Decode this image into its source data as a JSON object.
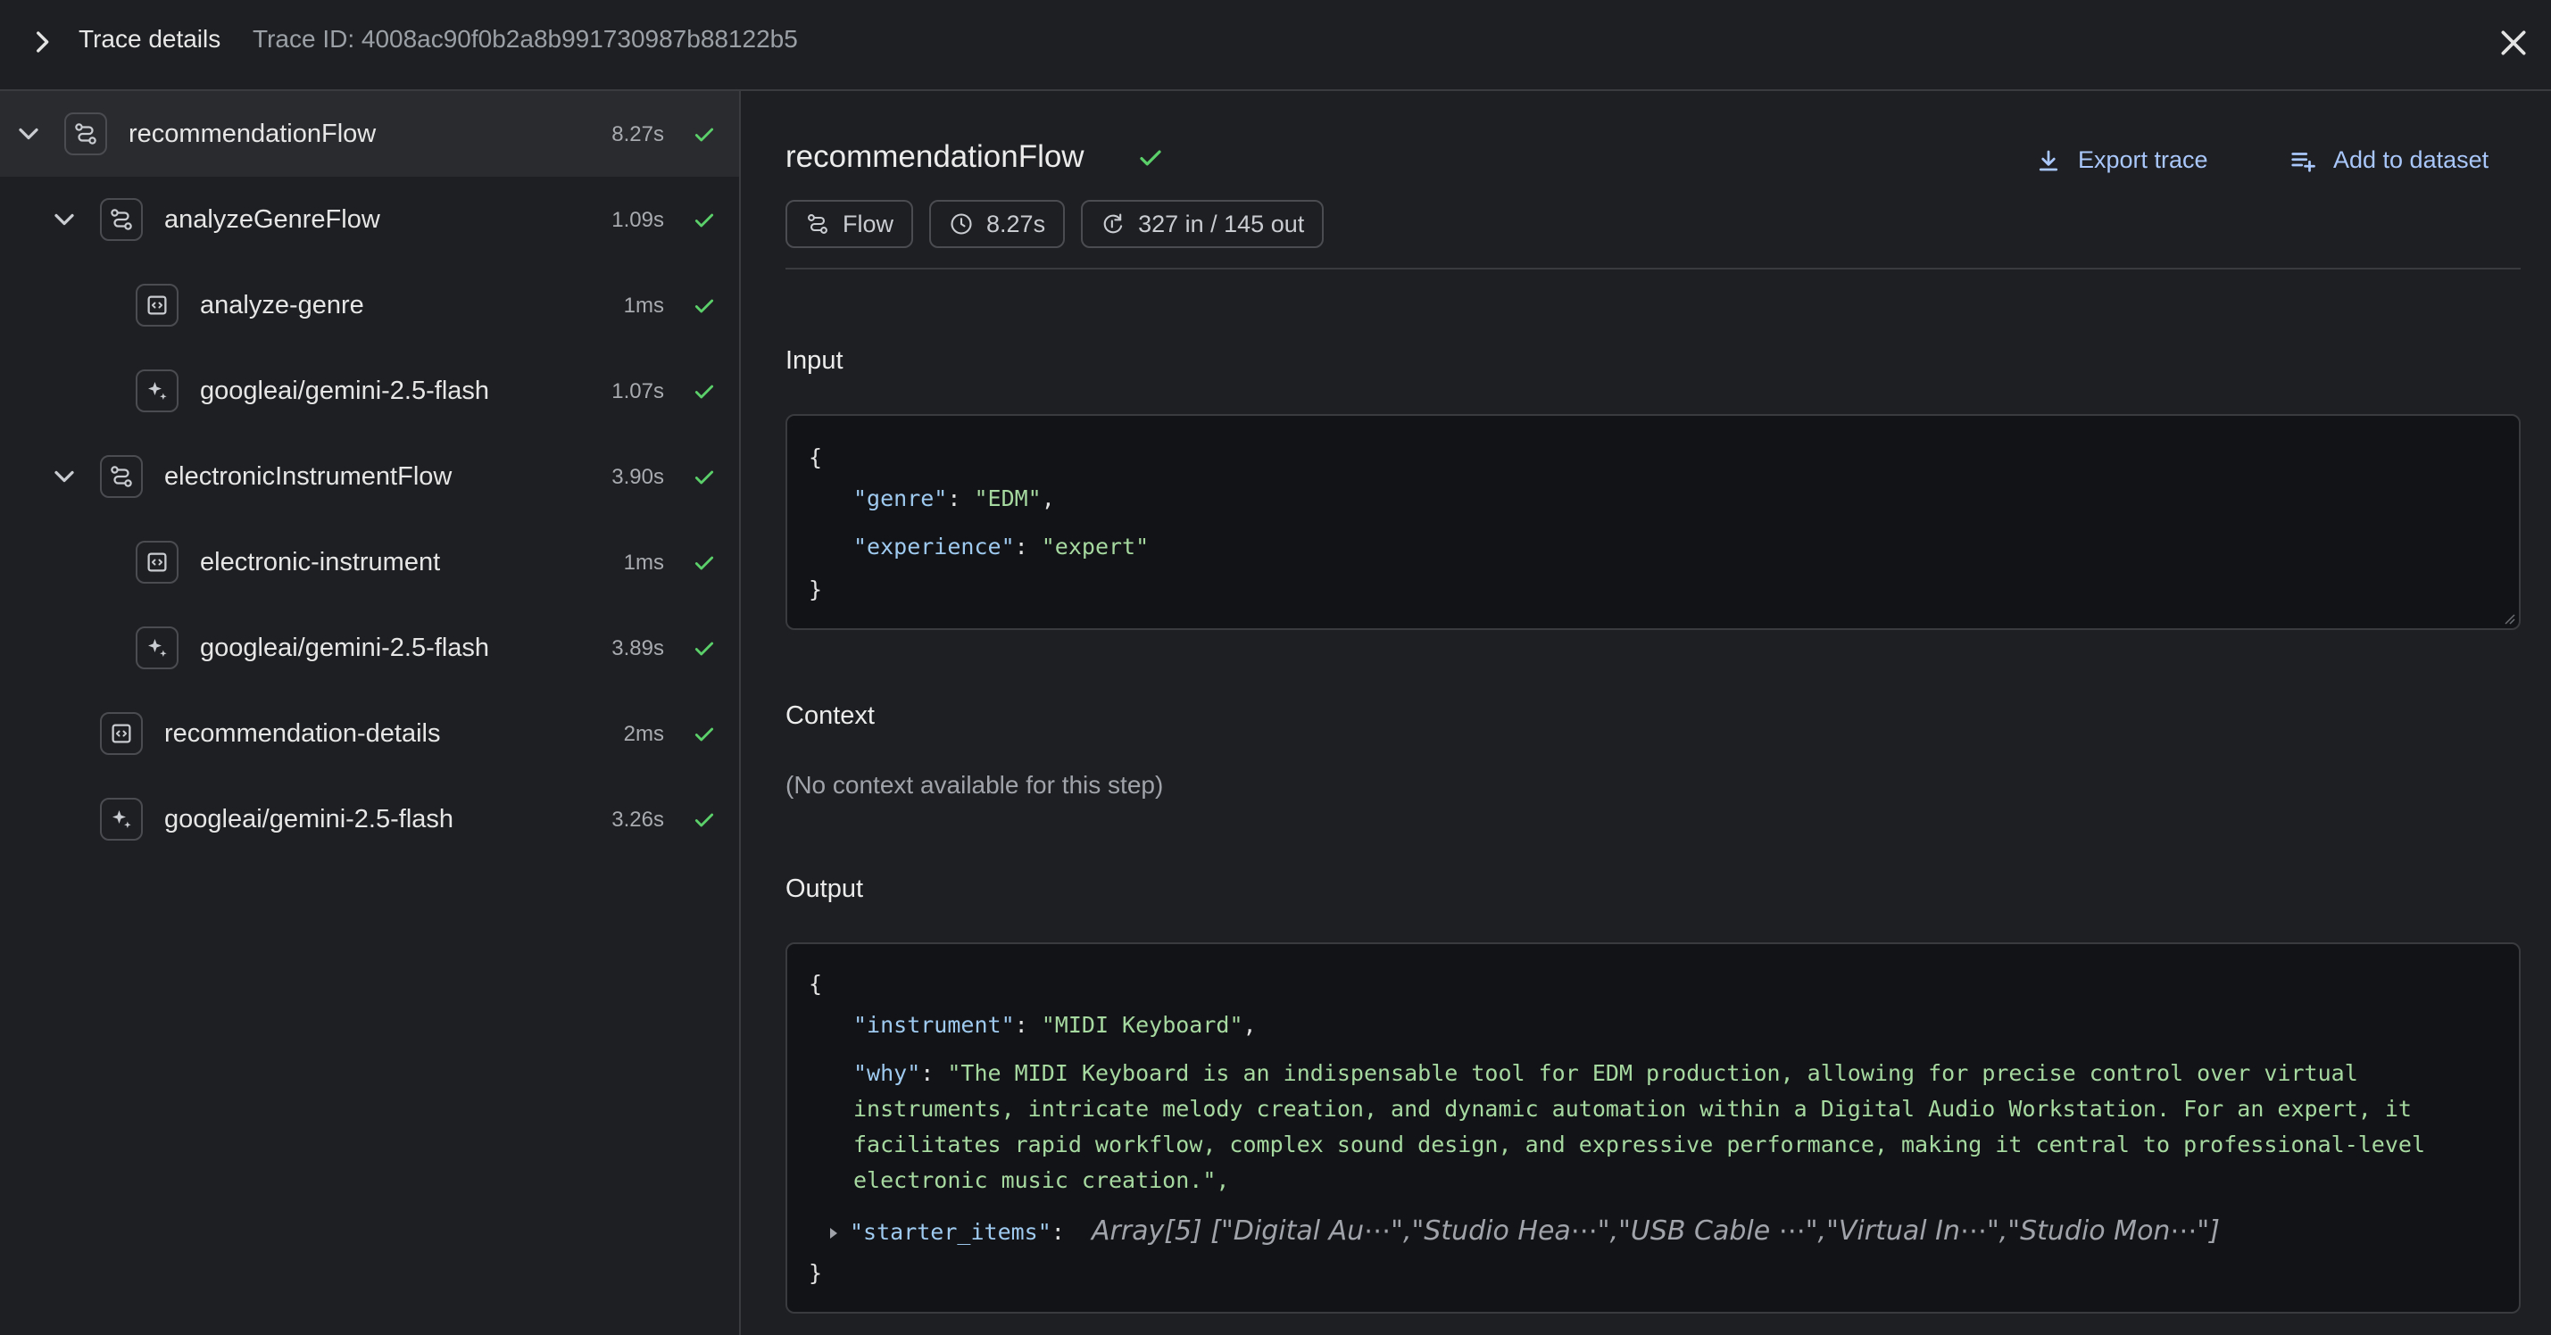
{
  "header": {
    "title": "Trace details",
    "trace_id": "Trace ID: 4008ac90f0b2a8b991730987b88122b5"
  },
  "tree": [
    {
      "label": "recommendationFlow",
      "duration": "8.27s",
      "level": 0,
      "kind": "flow",
      "expandable": true,
      "selected": true
    },
    {
      "label": "analyzeGenreFlow",
      "duration": "1.09s",
      "level": 1,
      "kind": "flow",
      "expandable": true,
      "selected": false
    },
    {
      "label": "analyze-genre",
      "duration": "1ms",
      "level": 2,
      "kind": "step",
      "expandable": false,
      "selected": false
    },
    {
      "label": "googleai/gemini-2.5-flash",
      "duration": "1.07s",
      "level": 2,
      "kind": "model",
      "expandable": false,
      "selected": false
    },
    {
      "label": "electronicInstrumentFlow",
      "duration": "3.90s",
      "level": 1,
      "kind": "flow",
      "expandable": true,
      "selected": false
    },
    {
      "label": "electronic-instrument",
      "duration": "1ms",
      "level": 2,
      "kind": "step",
      "expandable": false,
      "selected": false
    },
    {
      "label": "googleai/gemini-2.5-flash",
      "duration": "3.89s",
      "level": 2,
      "kind": "model",
      "expandable": false,
      "selected": false
    },
    {
      "label": "recommendation-details",
      "duration": "2ms",
      "level": 1,
      "kind": "step",
      "expandable": false,
      "selected": false
    },
    {
      "label": "googleai/gemini-2.5-flash",
      "duration": "3.26s",
      "level": 1,
      "kind": "model",
      "expandable": false,
      "selected": false
    }
  ],
  "detail": {
    "title": "recommendationFlow",
    "actions": {
      "export": "Export trace",
      "add_dataset": "Add to dataset"
    },
    "chips": {
      "type": "Flow",
      "duration": "8.27s",
      "tokens": "327 in / 145 out"
    },
    "input_label": "Input",
    "context_label": "Context",
    "context_empty": "(No context available for this step)",
    "output_label": "Output",
    "input": {
      "open": "{",
      "close": "}",
      "genre_key": "\"genre\"",
      "genre_val": "\"EDM\"",
      "experience_key": "\"experience\"",
      "experience_val": "\"expert\""
    },
    "output": {
      "open": "{",
      "close": "}",
      "instrument_key": "\"instrument\"",
      "instrument_val": "\"MIDI Keyboard\"",
      "why_key": "\"why\"",
      "why_lines": [
        "\"The MIDI Keyboard is an indispensable tool for EDM production, allowing for precise control over virtual",
        "instruments, intricate melody creation, and dynamic automation within a Digital Audio Workstation. For an expert, it",
        "facilitates rapid workflow, complex sound design, and expressive performance, making it central to professional-level",
        "electronic music creation.\","
      ],
      "starter_key": "\"starter_items\"",
      "starter_summary": "Array[5] [\"Digital Au⋯\",\"Studio Hea⋯\",\"USB Cable ⋯\",\"Virtual In⋯\",\"Studio Mon⋯\"]"
    }
  },
  "colors": {
    "accent": "#a9c7fa",
    "success": "#5bd06a",
    "key": "#9fcaf0",
    "string": "#a6d9a0"
  },
  "icons": {
    "flow": "flow-icon",
    "step": "function-icon",
    "model": "sparkle-icon"
  }
}
